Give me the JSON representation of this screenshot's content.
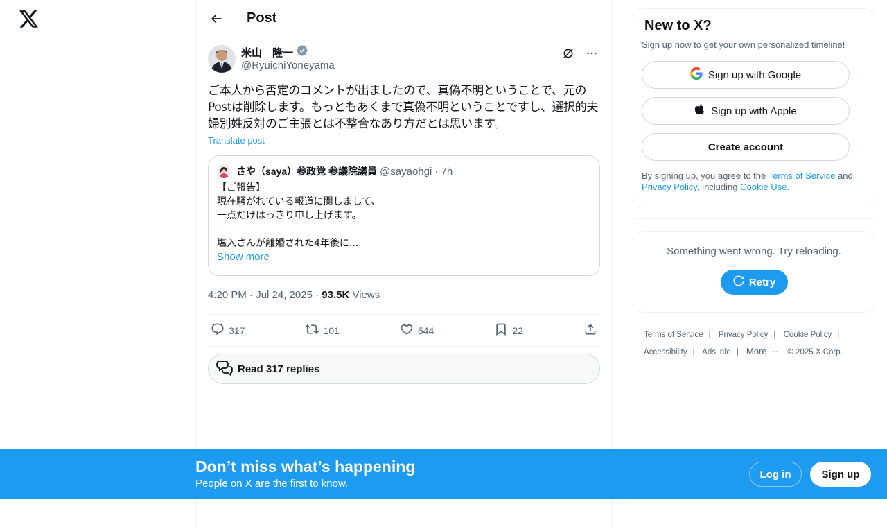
{
  "header": {
    "title": "Post"
  },
  "post": {
    "display_name": "米山　隆一",
    "handle": "@RyuichiYoneyama",
    "text": "ご本人から否定のコメントが出ましたので、真偽不明ということで、元のPostは削除します。もっともあくまで真偽不明ということですし、選択的夫婦別姓反対のご主張とは不整合なあり方だとは思います。",
    "translate": "Translate post",
    "quote": {
      "display_name": "さや（saya）参政党 参議院議員",
      "handle": "@sayaohgi",
      "time": "· 7h",
      "lines": [
        "【ご報告】",
        "現在騒がれている報道に関しまして、",
        "一点だけはっきり申し上げます。",
        "",
        "塩入さんが離婚された4年後に..."
      ],
      "show_more": "Show more"
    },
    "timestamp": "4:20 PM · Jul 24, 2025 · ",
    "views_count": "93.5K",
    "views_label": " Views",
    "replies": "317",
    "reposts": "101",
    "likes": "544",
    "bookmarks": "22",
    "read_replies": "Read 317 replies"
  },
  "sidebar": {
    "title": "New to X?",
    "subtitle": "Sign up now to get your own personalized timeline!",
    "google": "Sign up with Google",
    "apple": "Sign up with Apple",
    "create": "Create account",
    "legal_prefix": "By signing up, you agree to the ",
    "tos": "Terms of Service",
    "and": " and ",
    "privacy": "Privacy Policy",
    "including": ", including ",
    "cookie": "Cookie Use",
    "period": ".",
    "error": "Something went wrong. Try reloading.",
    "retry": "Retry"
  },
  "footer": {
    "links": [
      "Terms of Service",
      "Privacy Policy",
      "Cookie Policy",
      "Accessibility",
      "Ads info",
      "More ···"
    ],
    "copyright": "© 2025 X Corp."
  },
  "banner": {
    "title": "Don’t miss what’s happening",
    "subtitle": "People on X are the first to know.",
    "login": "Log in",
    "signup": "Sign up"
  },
  "colors": {
    "accent": "#1d9bf0",
    "text": "#0f1419",
    "muted": "#536471"
  },
  "icons": [
    "x-logo-icon",
    "back-arrow-icon",
    "verified-badge-icon",
    "grok-icon",
    "more-icon",
    "reply-icon",
    "repost-icon",
    "like-icon",
    "bookmark-icon",
    "share-icon",
    "replies-bubble-icon",
    "google-icon",
    "apple-icon",
    "retry-icon"
  ]
}
